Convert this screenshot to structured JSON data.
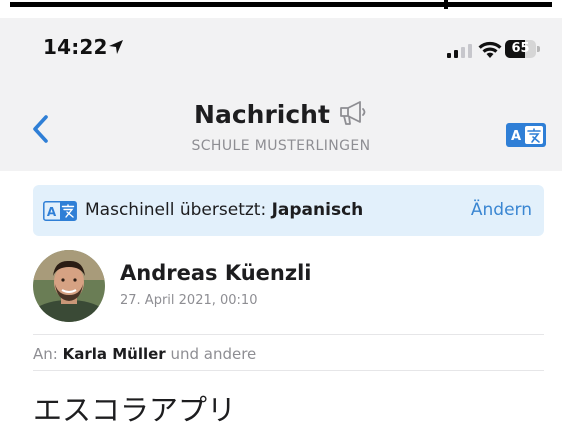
{
  "status_bar": {
    "time": "14:22",
    "battery_level": "65",
    "battery_fraction": 0.65
  },
  "nav": {
    "title": "Nachricht",
    "subtitle": "SCHULE MUSTERLINGEN",
    "translate_icon_glyph": "A文"
  },
  "banner": {
    "text_prefix": "Maschinell übersetzt: ",
    "language": "Japanisch",
    "change_label": "Ändern"
  },
  "message": {
    "sender_name": "Andreas Küenzli",
    "date": "27. April 2021, 00:10",
    "to_label": "An: ",
    "recipient": "Karla Müller",
    "others_label": " und andere",
    "subject": "エスコラアプリ"
  },
  "colors": {
    "accent": "#2f7fd6",
    "header_bg": "#f2f2f3",
    "banner_bg": "#e2f0fb",
    "link": "#3a86d2"
  },
  "icons": [
    "location-arrow-icon",
    "cellular-signal-icon",
    "wifi-icon",
    "battery-icon",
    "back-chevron-icon",
    "megaphone-icon",
    "translate-icon"
  ]
}
